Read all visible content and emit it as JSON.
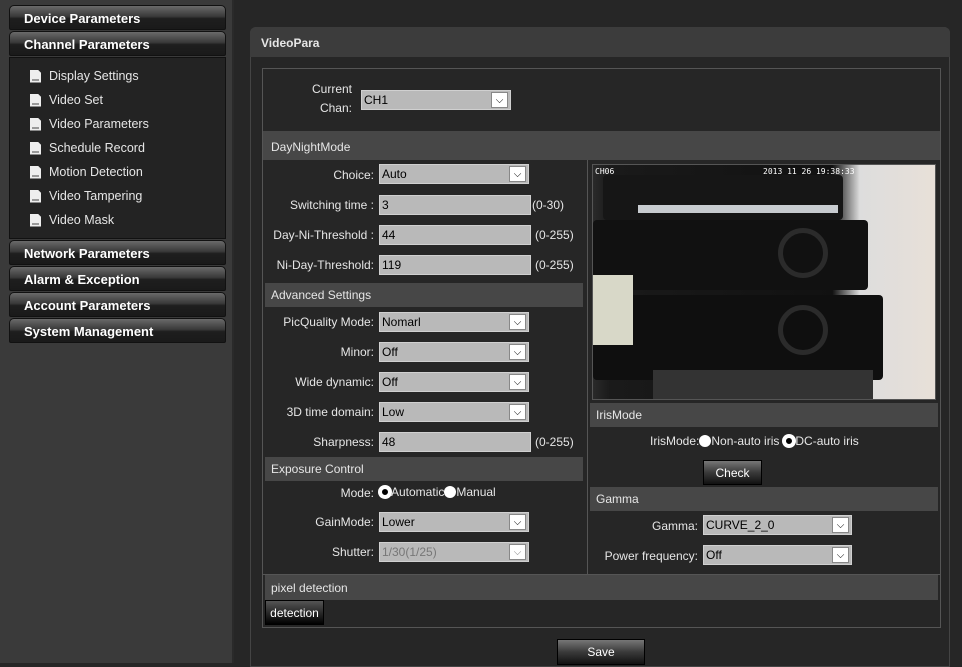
{
  "sidebar": {
    "sections": [
      "Device Parameters",
      "Channel Parameters",
      "Network Parameters",
      "Alarm & Exception",
      "Account Parameters",
      "System Management"
    ],
    "channel_items": [
      "Display Settings",
      "Video Set",
      "Video Parameters",
      "Schedule Record",
      "Motion Detection",
      "Video Tampering",
      "Video Mask"
    ]
  },
  "panel": {
    "title": "VideoPara",
    "current_chan_label": "Current Chan:",
    "current_chan_value": "CH1",
    "daynight": {
      "title": "DayNightMode",
      "choice_label": "Choice:",
      "choice_value": "Auto",
      "switching_label": "Switching time :",
      "switching_value": "3",
      "switching_range": "(0-30)",
      "day_ni_label": "Day-Ni-Threshold :",
      "day_ni_value": "44",
      "day_ni_range": "(0-255)",
      "ni_day_label": "Ni-Day-Threshold:",
      "ni_day_value": "119",
      "ni_day_range": "(0-255)"
    },
    "advanced": {
      "title": "Advanced Settings",
      "picq_label": "PicQuality Mode:",
      "picq_value": "Nomarl",
      "minor_label": "Minor:",
      "minor_value": "Off",
      "wide_label": "Wide dynamic:",
      "wide_value": "Off",
      "time3d_label": "3D time domain:",
      "time3d_value": "Low",
      "sharp_label": "Sharpness:",
      "sharp_value": "48",
      "sharp_range": "(0-255)"
    },
    "exposure": {
      "title": "Exposure Control",
      "mode_label": "Mode:",
      "mode_auto": "Automatic",
      "mode_manual": "Manual",
      "mode_selected": "Automatic",
      "gain_label": "GainMode:",
      "gain_value": "Lower",
      "shutter_label": "Shutter:",
      "shutter_value": "1/30(1/25)"
    },
    "video": {
      "osd_channel": "CH06",
      "osd_time": "2013 11 26 19:38:33"
    },
    "iris": {
      "title": "IrisMode",
      "label": "IrisMode:",
      "opt_non_auto": "Non-auto iris",
      "opt_dc_auto": "DC-auto iris",
      "selected": "DC-auto iris",
      "check_label": "Check"
    },
    "gamma": {
      "title": "Gamma",
      "gamma_label": "Gamma:",
      "gamma_value": "CURVE_2_0",
      "power_label": "Power frequency:",
      "power_value": "Off"
    },
    "pixel": {
      "title": "pixel detection",
      "button": "detection"
    },
    "save": "Save"
  }
}
